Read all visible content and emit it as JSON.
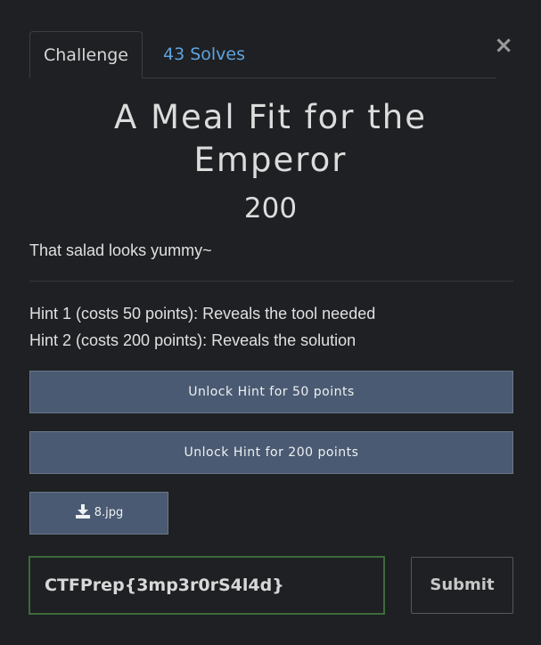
{
  "tabs": {
    "challenge_label": "Challenge",
    "solves_label": "43 Solves"
  },
  "close_icon": "×",
  "challenge": {
    "title_line1": "A Meal Fit for the",
    "title_line2": "Emperor",
    "value": "200",
    "description": "That salad looks yummy~"
  },
  "hints": [
    {
      "text": "Hint 1 (costs 50 points): Reveals the tool needed",
      "unlock_label": "Unlock Hint for 50 points"
    },
    {
      "text": "Hint 2 (costs 200 points): Reveals the solution",
      "unlock_label": "Unlock Hint for 200 points"
    }
  ],
  "file": {
    "icon": "download-icon",
    "name": "8.jpg"
  },
  "submission": {
    "value": "CTFPrep{3mp3r0rS4l4d}",
    "submit_label": "Submit"
  },
  "colors": {
    "background": "#1e2023",
    "link": "#5ea3e0",
    "button": "#4a5a72",
    "input_border": "#3c6b3a"
  }
}
